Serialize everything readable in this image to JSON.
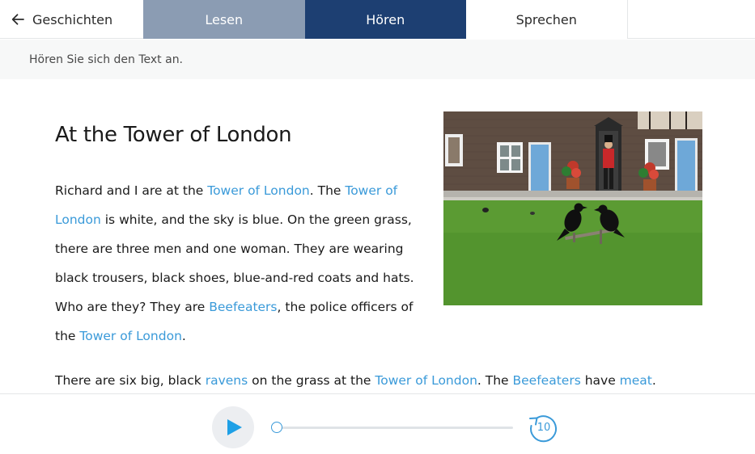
{
  "nav": {
    "back_label": "Geschichten",
    "tabs": [
      {
        "label": "Lesen",
        "state": "done"
      },
      {
        "label": "Hören",
        "state": "active"
      },
      {
        "label": "Sprechen",
        "state": "inactive"
      }
    ]
  },
  "instruction": "Hören Sie sich den Text an.",
  "story": {
    "title": "At the Tower of London",
    "p1": {
      "t1": "Richard and I are at the ",
      "l1": "Tower of London",
      "t2": ". The ",
      "l2": "Tower of London",
      "t3": " is white, and the sky is blue. On the green grass, there are three men and one woman. They are wearing black trousers, black shoes, blue-and-red coats and hats. Who are they? They are ",
      "l3": "Beefeaters",
      "t4": ", the police officers of the ",
      "l4": "Tower of London",
      "t5": "."
    },
    "p2": {
      "t1": "There are six big, black ",
      "l1": "ravens",
      "t2": " on the grass at the ",
      "l2": "Tower of London",
      "t3": ". The ",
      "l3": "Beefeaters",
      "t4": " have ",
      "l4": "meat",
      "t5": "."
    }
  },
  "player": {
    "progress": 0,
    "rewind_seconds": "10"
  },
  "colors": {
    "tab_done": "#8b9cb3",
    "tab_active": "#1d3f72",
    "link": "#3a9ad9",
    "accent": "#1ea0e6"
  },
  "icons": {
    "back": "arrow-left-icon",
    "play": "play-icon",
    "rewind": "rewind-10-icon"
  }
}
